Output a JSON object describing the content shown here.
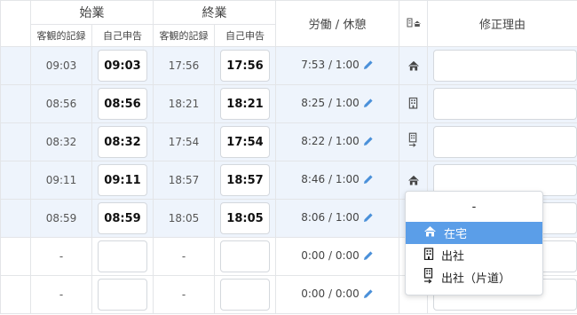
{
  "header": {
    "start": "始業",
    "end": "終業",
    "work_break": "労働 / 休憩",
    "place_icon": "building-home-icon",
    "reason": "修正理由",
    "objective": "客観的記録",
    "self_report": "自己申告"
  },
  "rows": [
    {
      "start_obj": "09:03",
      "start_self": "09:03",
      "end_obj": "17:56",
      "end_self": "17:56",
      "work": "7:53 / 1:00",
      "place": "home"
    },
    {
      "start_obj": "08:56",
      "start_self": "08:56",
      "end_obj": "18:21",
      "end_self": "18:21",
      "work": "8:25 / 1:00",
      "place": "office"
    },
    {
      "start_obj": "08:32",
      "start_self": "08:32",
      "end_obj": "17:54",
      "end_self": "17:54",
      "work": "8:22 / 1:00",
      "place": "office-oneway"
    },
    {
      "start_obj": "09:11",
      "start_self": "09:11",
      "end_obj": "18:57",
      "end_self": "18:57",
      "work": "8:46 / 1:00",
      "place": "home"
    },
    {
      "start_obj": "08:59",
      "start_self": "08:59",
      "end_obj": "18:05",
      "end_self": "18:05",
      "work": "8:06 / 1:00",
      "place": ""
    },
    {
      "start_obj": "-",
      "start_self": "",
      "end_obj": "-",
      "end_self": "",
      "work": "0:00 / 0:00",
      "place": ""
    },
    {
      "start_obj": "-",
      "start_self": "",
      "end_obj": "-",
      "end_self": "",
      "work": "0:00 / 0:00",
      "place": ""
    }
  ],
  "dropdown": {
    "options": [
      {
        "label": "-",
        "icon": ""
      },
      {
        "label": "在宅",
        "icon": "home-icon",
        "selected": true
      },
      {
        "label": "出社",
        "icon": "building-icon"
      },
      {
        "label": "出社（片道）",
        "icon": "building-arrow-icon"
      }
    ]
  },
  "colors": {
    "highlight": "#eef4fc",
    "selected": "#5b9ee8",
    "pencil": "#4a90d9"
  }
}
